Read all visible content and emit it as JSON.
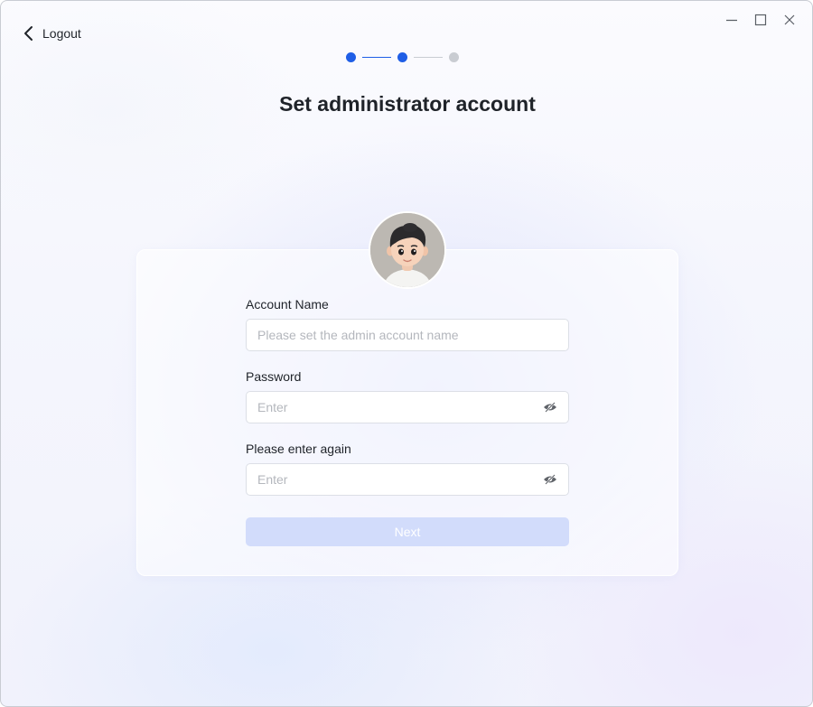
{
  "header": {
    "back_label": "Logout"
  },
  "stepper": {
    "total_steps": 3,
    "current_step": 2
  },
  "title": "Set administrator account",
  "form": {
    "account_name": {
      "label": "Account Name",
      "placeholder": "Please set the admin account name",
      "value": ""
    },
    "password": {
      "label": "Password",
      "placeholder": "Enter",
      "value": ""
    },
    "confirm_password": {
      "label": "Please enter again",
      "placeholder": "Enter",
      "value": ""
    },
    "next_label": "Next"
  },
  "icons": {
    "back": "chevron-left-icon",
    "minimize": "minimize-icon",
    "maximize": "maximize-icon",
    "close": "close-icon",
    "visibility": "eye-slash-icon"
  },
  "colors": {
    "accent": "#1f5ee6",
    "inactive": "#c9ccd2",
    "button_disabled": "#d2dcfb"
  }
}
